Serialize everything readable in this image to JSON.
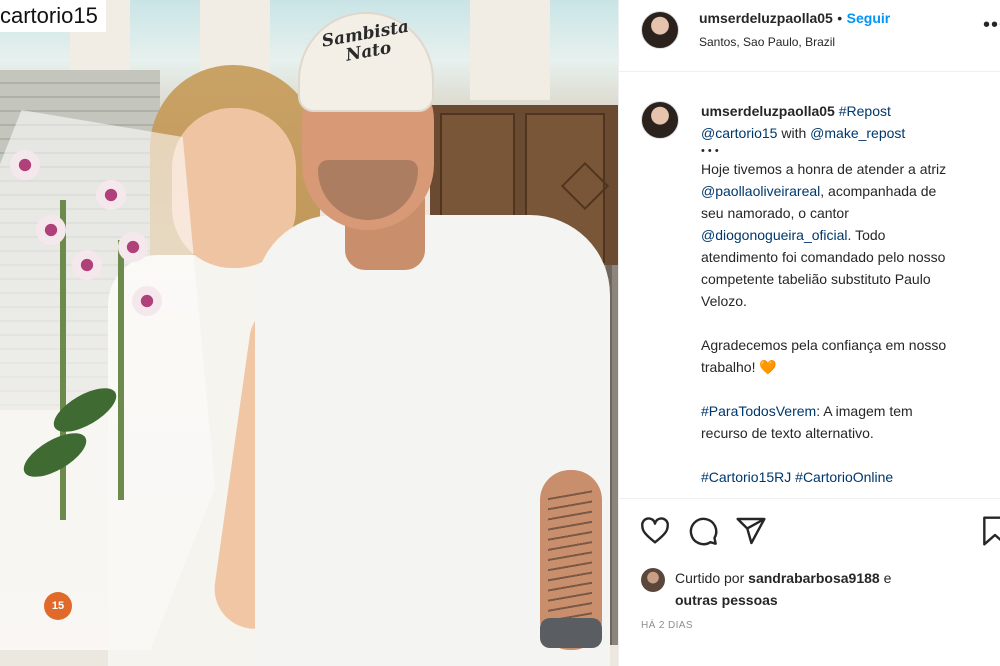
{
  "photo": {
    "watermark": "cartorio15",
    "cap_text_line1": "Sambista",
    "cap_text_line2": "Nato",
    "sticker_number": "15"
  },
  "header": {
    "username": "umserdeluzpaolla05",
    "separator": "•",
    "follow_label": "Seguir",
    "location": "Santos, Sao Paulo, Brazil",
    "more_icon": "•••"
  },
  "caption": {
    "username": "umserdeluzpaolla05",
    "hashtag_repost": "#Repost",
    "mention_cartorio": "@cartorio15",
    "with_text": " with ",
    "mention_make_repost": "@make_repost",
    "dots": "• • •",
    "line_hoje": "Hoje tivemos a honra de atender a atriz",
    "mention_paolla": "@paollaoliveirareal",
    "line_acompanhada": ", acompanhada de",
    "line_seu_namorado": "seu namorado, o cantor",
    "mention_diogo": "@diogonogueira_oficial",
    "line_todo": ". Todo",
    "line_atendimento": "atendimento foi comandado pelo nosso",
    "line_competente": "competente tabelião substituto Paulo",
    "line_velozo": "Velozo.",
    "line_agradecemos": "Agradecemos pela confiança em nosso",
    "line_trabalho": "trabalho! ",
    "heart_emoji": "🧡",
    "hashtag_paratodos": "#ParaTodosVerem",
    "line_imagem": ": A imagem tem",
    "line_recurso": "recurso de texto alternativo.",
    "hashtag_cartorio15rj": "#Cartorio15RJ",
    "hashtag_cartorioonline": "#CartorioOnline"
  },
  "likes": {
    "prefix": "Curtido por ",
    "user": "sandrabarbosa9188",
    "joiner": " e",
    "others": "outras pessoas"
  },
  "timestamp": "HÁ 2 DIAS",
  "icons": [
    "heart-icon",
    "comment-icon",
    "share-icon",
    "bookmark-icon",
    "more-options-icon"
  ],
  "colors": {
    "link_blue": "#0095f6",
    "tag_blue": "#00376b",
    "text": "#262626",
    "muted": "#8e8e8e"
  }
}
